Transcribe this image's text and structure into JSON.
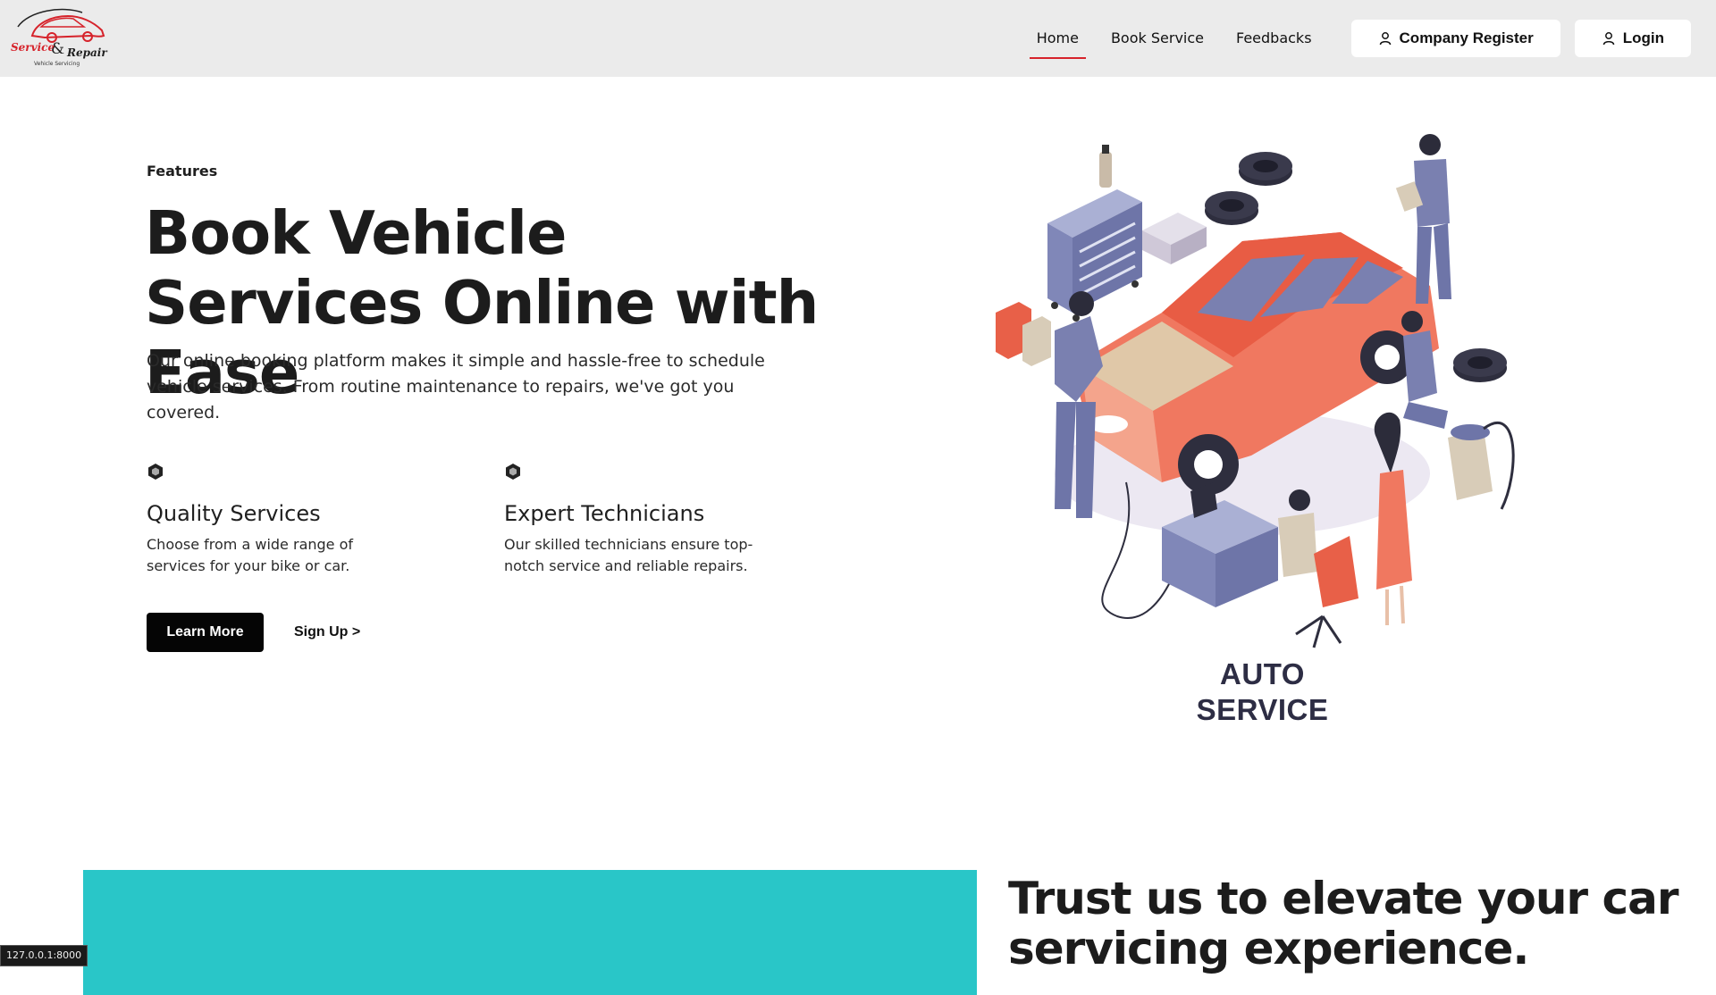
{
  "brand": {
    "logo_word1": "Service",
    "logo_amp": "&",
    "logo_word2": "Repair",
    "logo_tagline": "Vehicle Servicing",
    "primary_red": "#d6232b"
  },
  "nav": {
    "links": [
      {
        "label": "Home",
        "active": true
      },
      {
        "label": "Book Service",
        "active": false
      },
      {
        "label": "Feedbacks",
        "active": false
      }
    ],
    "company_register_label": "Company Register",
    "login_label": "Login",
    "button_icon": "user-icon"
  },
  "hero": {
    "eyebrow": "Features",
    "title": "Book Vehicle Services Online with Ease",
    "description": "Our online booking platform makes it simple and hassle-free to schedule vehicle services. From routine maintenance to repairs, we've got you covered.",
    "features": [
      {
        "icon": "cube-icon",
        "title": "Quality Services",
        "text": "Choose from a wide range of services for your bike or car."
      },
      {
        "icon": "cube-icon",
        "title": "Expert Technicians",
        "text": "Our skilled technicians ensure top-notch service and reliable repairs."
      }
    ],
    "learn_more_label": "Learn More",
    "signup_label": "Sign Up >"
  },
  "illustration": {
    "caption": "AUTO SERVICE",
    "colors": {
      "car": "#f07860",
      "uniform": "#7a80b0",
      "tire": "#2e2e3e"
    }
  },
  "section2": {
    "title": "Trust us to elevate your car servicing experience.",
    "block_color": "#29c6c8"
  },
  "status_bar": {
    "url": "127.0.0.1:8000"
  }
}
